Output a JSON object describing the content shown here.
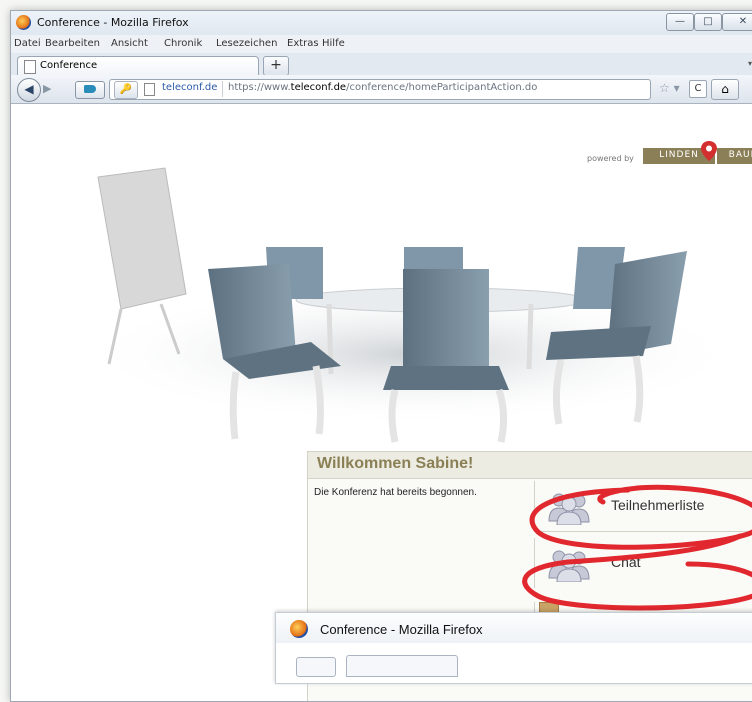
{
  "window": {
    "title": "Conference - Mozilla Firefox",
    "controls": {
      "minimize": "—",
      "maximize": "□",
      "close": "✕"
    }
  },
  "menubar": {
    "items": [
      "Datei",
      "Bearbeiten",
      "Ansicht",
      "Chronik",
      "Lesezeichen",
      "Extras",
      "Hilfe"
    ]
  },
  "tabs": [
    {
      "label": "Conference",
      "active": true
    }
  ],
  "newtab_label": "+",
  "navbar": {
    "back_icon": "arrow-left-icon",
    "site_identity": "teleconf.de",
    "url_prefix": "https://www.",
    "url_domain": "teleconf.de",
    "url_path": "/conference/homeParticipantAction.do",
    "star_glyph": "☆ ▾",
    "reload_glyph": "C",
    "home_glyph": "⌂"
  },
  "branding": {
    "powered_by": "powered by",
    "logo_left": "LINDEN",
    "logo_right": "BAUM",
    "logo_color": "#8b7f58",
    "pin_color": "#d32f2f"
  },
  "welcome": {
    "title": "Willkommen  Sabine!",
    "status": "Die Konferenz hat bereits begonnen.",
    "participants_button": "Teilnehmerliste",
    "chat_button": "Chat",
    "title_color": "#8b8055",
    "highlight_color": "#e0282e"
  },
  "bottom_window": {
    "title": "Conference - Mozilla Firefox"
  }
}
